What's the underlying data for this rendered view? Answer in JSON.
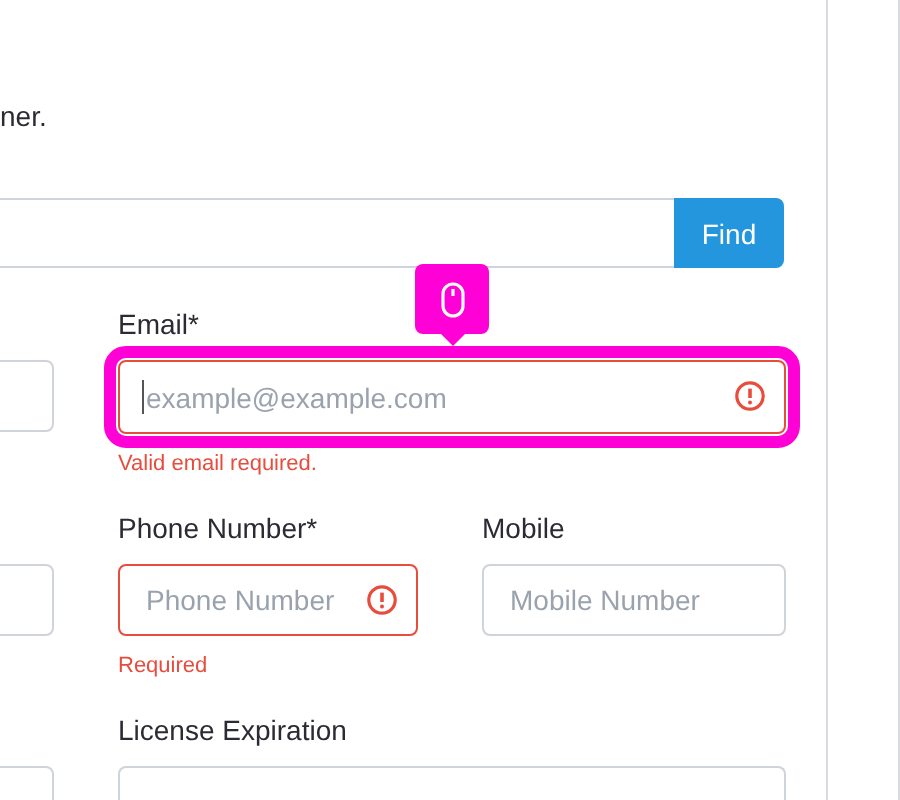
{
  "intro": {
    "text": "ner."
  },
  "search": {
    "button": "Find"
  },
  "rows": [
    {
      "left_field": {
        "invalid": false
      },
      "fields": [
        {
          "label": "Email*",
          "placeholder": "example@example.com",
          "invalid": true,
          "focused": true,
          "highlighted": true,
          "error": "Valid email required."
        }
      ]
    },
    {
      "left_field": {
        "invalid": false
      },
      "fields": [
        {
          "label": "Phone Number*",
          "placeholder": "Phone Number",
          "invalid": true,
          "focused": false,
          "highlighted": false,
          "error": "Required"
        },
        {
          "label": "Mobile",
          "placeholder": "Mobile Number",
          "invalid": false,
          "focused": false,
          "highlighted": false
        }
      ]
    },
    {
      "left_field": {
        "invalid": false
      },
      "fields": [
        {
          "label": "License Expiration",
          "invalid": false,
          "focused": false,
          "highlighted": false
        }
      ]
    }
  ]
}
